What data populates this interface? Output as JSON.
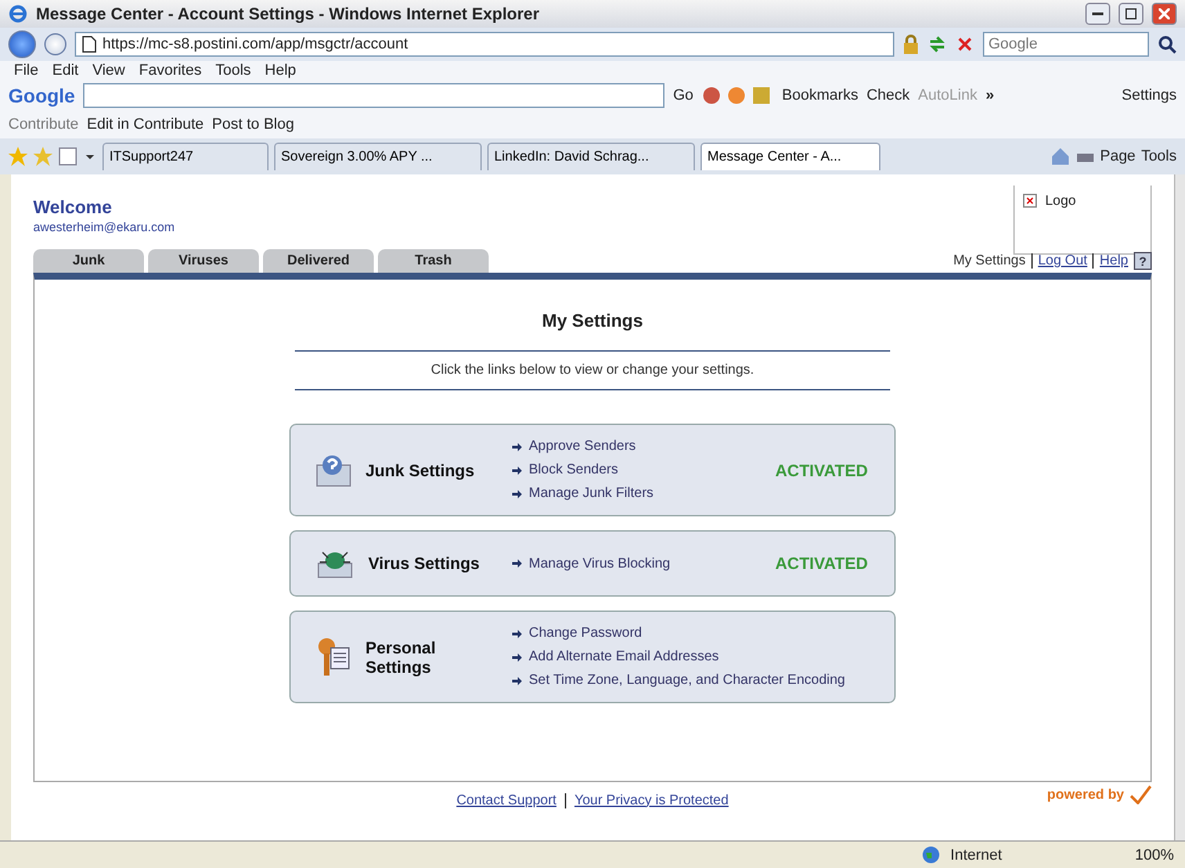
{
  "window": {
    "title": "Message Center - Account Settings - Windows Internet Explorer"
  },
  "address_bar": {
    "url": "https://mc-s8.postini.com/app/msgctr/account",
    "search_placeholder": "Google"
  },
  "menu": [
    "File",
    "Edit",
    "View",
    "Favorites",
    "Tools",
    "Help"
  ],
  "google_toolbar": {
    "brand": "Google",
    "go": "Go",
    "bookmarks": "Bookmarks",
    "check": "Check",
    "autolink": "AutoLink",
    "more": "»",
    "settings": "Settings"
  },
  "contribute_bar": {
    "label": "Contribute",
    "items": [
      "Edit in Contribute",
      "Post to Blog"
    ]
  },
  "browser_tabs": [
    {
      "label": "ITSupport247",
      "selected": false
    },
    {
      "label": "Sovereign 3.00% APY ...",
      "selected": false
    },
    {
      "label": "LinkedIn: David Schrag...",
      "selected": false
    },
    {
      "label": "Message Center - A...",
      "selected": true
    }
  ],
  "command_bar": {
    "page": "Page",
    "tools": "Tools"
  },
  "page": {
    "welcome": "Welcome",
    "email": "awesterheim@ekaru.com",
    "logo": "Logo",
    "tabs": [
      "Junk",
      "Viruses",
      "Delivered",
      "Trash"
    ],
    "user_links": [
      {
        "label": "My Settings",
        "selected": true
      },
      {
        "label": "Log Out",
        "selected": false
      },
      {
        "label": "Help",
        "selected": false
      }
    ],
    "help_icon": "?",
    "heading": "My Settings",
    "intro": "Click the links below to view or change your settings.",
    "sections": [
      {
        "kind": "junk",
        "title": "Junk Settings",
        "links": [
          "Approve Senders",
          "Block Senders",
          "Manage Junk Filters"
        ],
        "status": "ACTIVATED"
      },
      {
        "kind": "virus",
        "title": "Virus Settings",
        "links": [
          "Manage Virus Blocking"
        ],
        "status": "ACTIVATED"
      },
      {
        "kind": "personal",
        "title": "Personal Settings",
        "links": [
          "Change Password",
          "Add Alternate Email Addresses",
          "Set Time Zone, Language, and Character Encoding"
        ]
      }
    ],
    "footer_links": [
      "Contact Support",
      "Your Privacy is Protected"
    ],
    "powered_by": "powered by"
  },
  "status_bar": {
    "zone": "Internet",
    "zoom": "100%"
  }
}
